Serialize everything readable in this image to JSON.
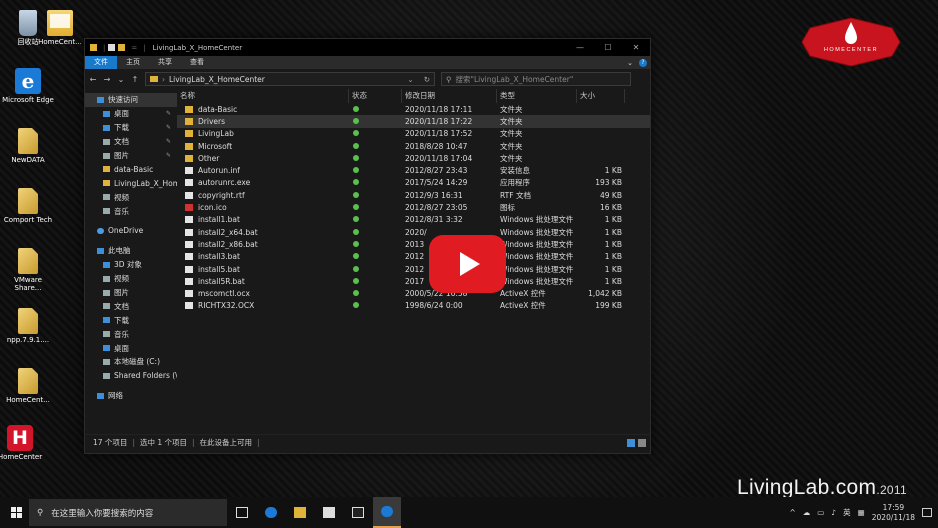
{
  "desktop": {
    "icons": [
      {
        "label": "回收站",
        "icon": "recycle-bin-icon"
      },
      {
        "label": "HomeCent...",
        "icon": "homecenter-shortcut-icon"
      },
      {
        "label": "Microsoft Edge",
        "icon": "edge-icon"
      },
      {
        "label": "NewDATA",
        "icon": "file-icon"
      },
      {
        "label": "Comport Tech",
        "icon": "file-icon"
      },
      {
        "label": "VMware Share...",
        "icon": "file-icon"
      },
      {
        "label": "npp.7.9.1....",
        "icon": "file-icon"
      },
      {
        "label": "HomeCent...",
        "icon": "file-icon"
      },
      {
        "label": "HomeCenter",
        "icon": "homecenter-app-icon"
      }
    ]
  },
  "logo_text": "HOMECENTER",
  "watermark": {
    "main": "LivingLab.com",
    "year": ".2011"
  },
  "window": {
    "title": "LivingLab_X_HomeCenter",
    "controls": [
      "—",
      "☐",
      "✕"
    ],
    "ribbon_tabs": [
      "文件",
      "主页",
      "共享",
      "查看"
    ],
    "address_path": "LivingLab_X_HomeCenter",
    "search_placeholder": "搜索\"LivingLab_X_HomeCenter\"",
    "nav": [
      {
        "label": "快速访问",
        "icon": "star-icon",
        "color": "blue",
        "selected": true
      },
      {
        "label": "桌面",
        "icon": "desktop-icon",
        "color": "blue",
        "pinned": true
      },
      {
        "label": "下载",
        "icon": "download-icon",
        "color": "blue",
        "pinned": true
      },
      {
        "label": "文档",
        "icon": "documents-icon",
        "color": "gray",
        "pinned": true
      },
      {
        "label": "图片",
        "icon": "pictures-icon",
        "color": "gray",
        "pinned": true
      },
      {
        "label": "data-Basic",
        "icon": "folder-icon",
        "color": "yellow"
      },
      {
        "label": "LivingLab_X_Home",
        "icon": "folder-icon",
        "color": "yellow"
      },
      {
        "label": "视频",
        "icon": "videos-icon",
        "color": "gray"
      },
      {
        "label": "音乐",
        "icon": "music-icon",
        "color": "gray"
      },
      {
        "label": "",
        "icon": "spacer",
        "color": ""
      },
      {
        "label": "OneDrive",
        "icon": "onedrive-icon",
        "color": "cloud"
      },
      {
        "label": "",
        "icon": "spacer",
        "color": ""
      },
      {
        "label": "此电脑",
        "icon": "this-pc-icon",
        "color": "blue"
      },
      {
        "label": "3D 对象",
        "icon": "3d-objects-icon",
        "color": "blue"
      },
      {
        "label": "视频",
        "icon": "videos-icon",
        "color": "gray"
      },
      {
        "label": "图片",
        "icon": "pictures-icon",
        "color": "gray"
      },
      {
        "label": "文档",
        "icon": "documents-icon",
        "color": "gray"
      },
      {
        "label": "下载",
        "icon": "download-icon",
        "color": "blue"
      },
      {
        "label": "音乐",
        "icon": "music-icon",
        "color": "gray"
      },
      {
        "label": "桌面",
        "icon": "desktop-icon",
        "color": "blue"
      },
      {
        "label": "本地磁盘 (C:)",
        "icon": "drive-icon",
        "color": "gray"
      },
      {
        "label": "Shared Folders (\\\\v",
        "icon": "network-drive-icon",
        "color": "gray"
      },
      {
        "label": "",
        "icon": "spacer",
        "color": ""
      },
      {
        "label": "网络",
        "icon": "network-icon",
        "color": "blue"
      }
    ],
    "columns": {
      "name": "名称",
      "status": "状态",
      "date": "修改日期",
      "type": "类型",
      "size": "大小"
    },
    "files": [
      {
        "name": "data-Basic",
        "date": "2020/11/18 17:11",
        "type": "文件夹",
        "size": "",
        "kind": "folder"
      },
      {
        "name": "Drivers",
        "date": "2020/11/18 17:22",
        "type": "文件夹",
        "size": "",
        "kind": "folder",
        "selected": true
      },
      {
        "name": "LivingLab",
        "date": "2020/11/18 17:52",
        "type": "文件夹",
        "size": "",
        "kind": "folder"
      },
      {
        "name": "Microsoft",
        "date": "2018/8/28 10:47",
        "type": "文件夹",
        "size": "",
        "kind": "folder"
      },
      {
        "name": "Other",
        "date": "2020/11/18 17:04",
        "type": "文件夹",
        "size": "",
        "kind": "folder"
      },
      {
        "name": "Autorun.inf",
        "date": "2012/8/27 23:43",
        "type": "安装信息",
        "size": "1 KB",
        "kind": "file"
      },
      {
        "name": "autorunrc.exe",
        "date": "2017/5/24 14:29",
        "type": "应用程序",
        "size": "193 KB",
        "kind": "file"
      },
      {
        "name": "copyright.rtf",
        "date": "2012/9/3 16:31",
        "type": "RTF 文档",
        "size": "49 KB",
        "kind": "file"
      },
      {
        "name": "icon.ico",
        "date": "2012/8/27 23:05",
        "type": "图标",
        "size": "16 KB",
        "kind": "red"
      },
      {
        "name": "install1.bat",
        "date": "2012/8/31 3:32",
        "type": "Windows 批处理文件",
        "size": "1 KB",
        "kind": "file"
      },
      {
        "name": "install2_x64.bat",
        "date": "2020/",
        "type": "Windows 批处理文件",
        "size": "1 KB",
        "kind": "file"
      },
      {
        "name": "install2_x86.bat",
        "date": "2013",
        "type": "Windows 批处理文件",
        "size": "1 KB",
        "kind": "file"
      },
      {
        "name": "install3.bat",
        "date": "2012",
        "type": "Windows 批处理文件",
        "size": "1 KB",
        "kind": "file"
      },
      {
        "name": "install5.bat",
        "date": "2012",
        "type": "Windows 批处理文件",
        "size": "1 KB",
        "kind": "file"
      },
      {
        "name": "install5R.bat",
        "date": "2017",
        "type": "Windows 批处理文件",
        "size": "1 KB",
        "kind": "file"
      },
      {
        "name": "mscomctl.ocx",
        "date": "2000/5/22 16:58",
        "type": "ActiveX 控件",
        "size": "1,042 KB",
        "kind": "file"
      },
      {
        "name": "RICHTX32.OCX",
        "date": "1998/6/24 0:00",
        "type": "ActiveX 控件",
        "size": "199 KB",
        "kind": "file"
      }
    ],
    "status": {
      "count": "17 个项目",
      "selected": "选中 1 个项目",
      "available": "在此设备上可用"
    }
  },
  "taskbar": {
    "search_placeholder": "在这里输入你要搜索的内容",
    "icons": [
      "task-view-icon",
      "edge-icon",
      "file-explorer-icon",
      "store-icon",
      "mail-icon",
      "info-app-icon"
    ],
    "tray_lang": "英",
    "time": "17:59",
    "date": "2020/11/18"
  },
  "colors": {
    "accent": "#1979ca",
    "play": "#e01b22",
    "status_ok": "#5bbf4e",
    "folder": "#e0b23a"
  }
}
